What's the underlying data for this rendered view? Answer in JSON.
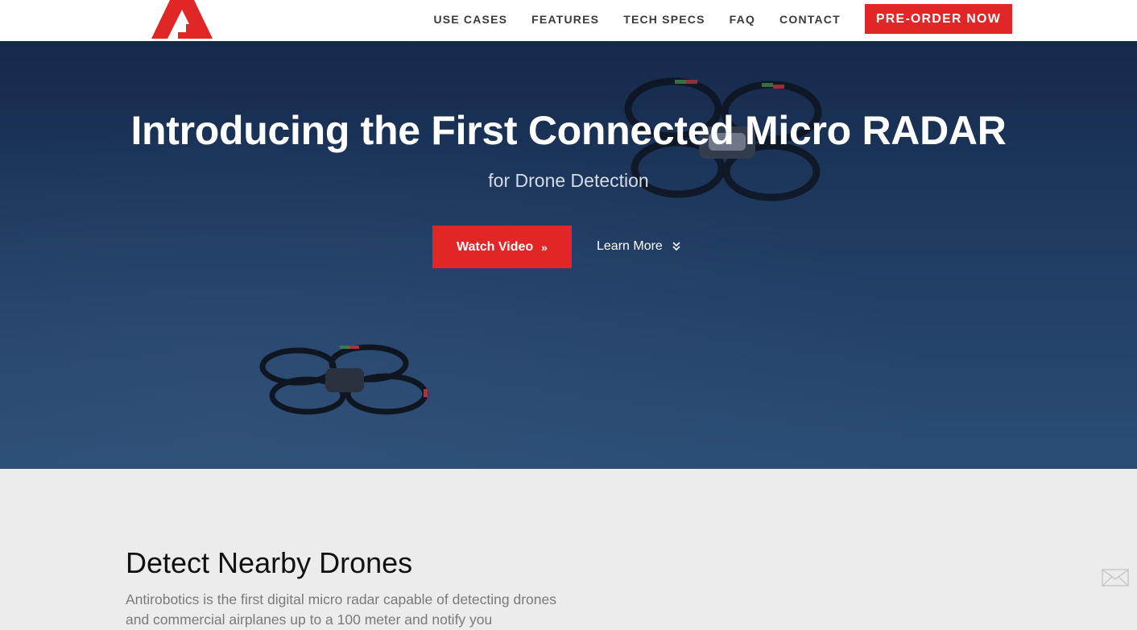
{
  "header": {
    "logo_icon": "antirobotics-a-logo",
    "nav": [
      {
        "label": "USE CASES"
      },
      {
        "label": "FEATURES"
      },
      {
        "label": "TECH SPECS"
      },
      {
        "label": "FAQ"
      },
      {
        "label": "CONTACT"
      }
    ],
    "cta_label": "PRE-ORDER NOW"
  },
  "hero": {
    "title": "Introducing the First Connected Micro RADAR",
    "subtitle": "for Drone Detection",
    "watch_video_label": "Watch Video",
    "learn_more_label": "Learn More"
  },
  "section": {
    "title": "Detect Nearby Drones",
    "text": "Antirobotics is the first digital micro radar capable of detecting drones and commercial airplanes up to a 100 meter and notify you"
  },
  "floating": {
    "icon": "mail-icon"
  },
  "colors": {
    "accent": "#e02626",
    "hero_bg": "#1f3b62",
    "content_bg": "#ececec"
  }
}
